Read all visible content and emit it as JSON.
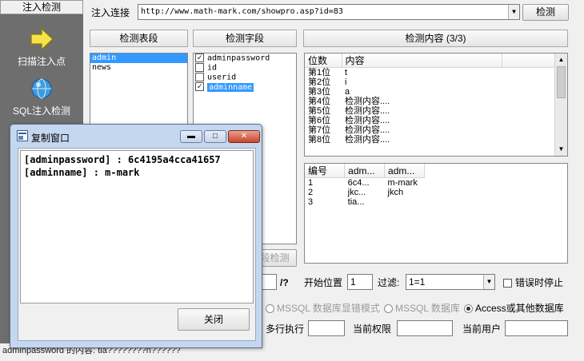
{
  "nav": {
    "header": "注入检测",
    "items": [
      {
        "label": "扫描注入点",
        "icon": "arrow-right-icon"
      },
      {
        "label": "SQL注入检测",
        "icon": "globe-icon"
      }
    ]
  },
  "toolbar": {
    "url_label": "注入连接",
    "url_value": "http://www.math-mark.com/showpro.asp?id=83",
    "detect_button": "检测"
  },
  "tables_panel": {
    "header": "检测表段",
    "items": [
      "admin",
      "news"
    ],
    "selected": "admin"
  },
  "fields_panel": {
    "header": "检测字段",
    "items": [
      {
        "label": "adminpassword",
        "checked": true
      },
      {
        "label": "id",
        "checked": false
      },
      {
        "label": "userid",
        "checked": false
      },
      {
        "label": "adminname",
        "checked": true
      }
    ],
    "selected": "adminname",
    "detect_button_partial": "段检测"
  },
  "content_panel": {
    "header": "检测内容 (3/3)",
    "columns": [
      "位数",
      "内容"
    ],
    "rows": [
      [
        "第1位",
        "t"
      ],
      [
        "第2位",
        "i"
      ],
      [
        "第3位",
        "a"
      ],
      [
        "第4位",
        "检测内容...."
      ],
      [
        "第5位",
        "检测内容...."
      ],
      [
        "第6位",
        "检测内容...."
      ],
      [
        "第7位",
        "检测内容...."
      ],
      [
        "第8位",
        "检测内容...."
      ]
    ]
  },
  "results_panel": {
    "columns": [
      "编号",
      "adm...",
      "adm..."
    ],
    "rows": [
      [
        "1",
        "6c4...",
        "m-mark"
      ],
      [
        "2",
        "jkc...",
        "jkch"
      ],
      [
        "3",
        "tia...",
        ""
      ]
    ]
  },
  "options": {
    "slash_q": "/?",
    "start_pos_label": "开始位置",
    "start_pos_value": "1",
    "filter_label": "过滤:",
    "filter_value": "1=1",
    "stop_on_error_label": "错误时停止",
    "mode_mssql_error": "MSSQL 数据库显错模式",
    "mode_mssql": "MSSQL 数据库",
    "mode_access": "Access或其他数据库",
    "multi_exec_label": "多行执行",
    "cur_perm_label": "当前权限",
    "cur_user_label": "当前用户"
  },
  "dialog": {
    "title": "复制窗口",
    "lines": [
      "[adminpassword] : 6c4195a4cca41657",
      "[adminname] : m-mark"
    ],
    "close_button": "关闭"
  },
  "status_text": "adminpassword 的内容: tia????????n??????"
}
